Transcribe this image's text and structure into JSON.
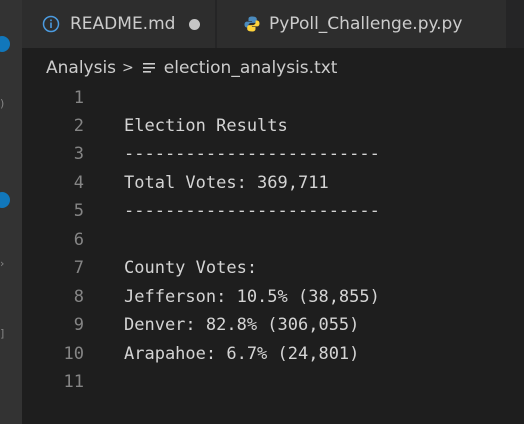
{
  "tabs": [
    {
      "label": "README.md",
      "icon": "info-icon",
      "dirty": true
    },
    {
      "label": "PyPoll_Challenge.py.py",
      "icon": "python-icon",
      "dirty": false
    }
  ],
  "breadcrumb": {
    "folder": "Analysis",
    "separator": ">",
    "file": "election_analysis.txt"
  },
  "editor": {
    "lines": [
      {
        "number": "1",
        "text": ""
      },
      {
        "number": "2",
        "text": "Election Results"
      },
      {
        "number": "3",
        "text": "-------------------------"
      },
      {
        "number": "4",
        "text": "Total Votes: 369,711"
      },
      {
        "number": "5",
        "text": "-------------------------"
      },
      {
        "number": "6",
        "text": ""
      },
      {
        "number": "7",
        "text": "County Votes:"
      },
      {
        "number": "8",
        "text": "Jefferson: 10.5% (38,855)"
      },
      {
        "number": "9",
        "text": "Denver: 82.8% (306,055)"
      },
      {
        "number": "10",
        "text": "Arapahoe: 6.7% (24,801)"
      },
      {
        "number": "11",
        "text": ""
      }
    ]
  },
  "colors": {
    "background": "#1e1e1e",
    "tab_active": "#2d2d2d",
    "text": "#d4d4d4",
    "line_number": "#858585",
    "accent": "#1177bb",
    "python_blue": "#4b8bbe",
    "python_yellow": "#ffd43b"
  }
}
